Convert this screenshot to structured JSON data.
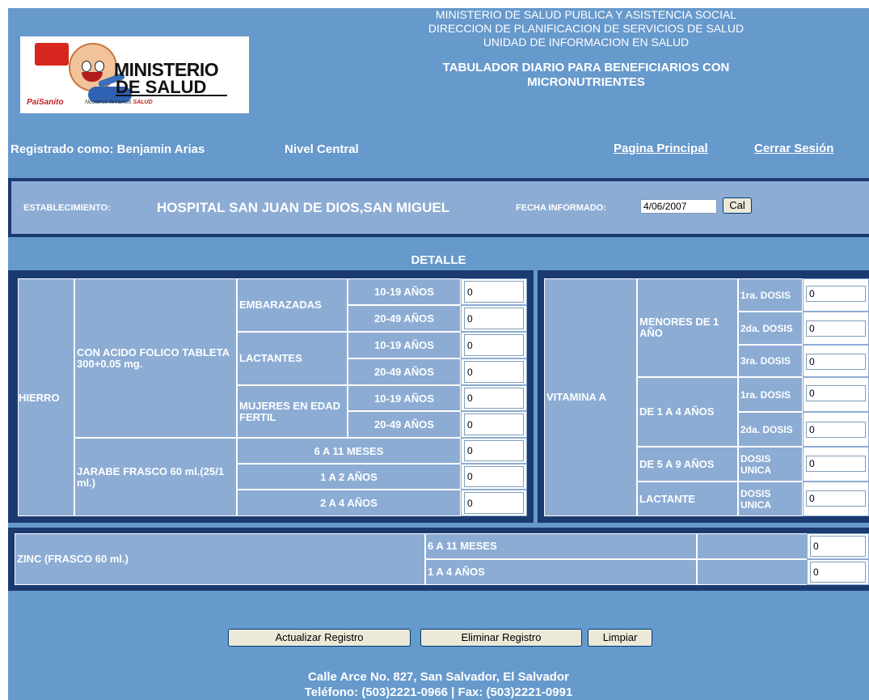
{
  "header": {
    "line1": "MINISTERIO DE SALUD PUBLICA Y ASISTENCIA SOCIAL",
    "line2": "DIRECCION DE PLANIFICACION DE SERVICIOS DE SALUD",
    "line3": "UNIDAD DE INFORMACION EN SALUD",
    "title1": "TABULADOR DIARIO PARA BENEFICIARIOS CON",
    "title2": "MICRONUTRIENTES"
  },
  "logo": {
    "line1": "MINISTERIO",
    "line2": "DE SALUD",
    "brand": "PaiSanito",
    "slogan": "Nosotros llevamos",
    "slogan_strong": "SALUD"
  },
  "user": {
    "registered_as": "Registrado como: Benjamin Arias",
    "level": "Nivel Central"
  },
  "nav": {
    "home": "Pagina Principal",
    "logout": "Cerrar Sesión"
  },
  "establishment": {
    "label": "ESTABLECIMIENTO:",
    "value": "HOSPITAL SAN JUAN DE DIOS,SAN MIGUEL",
    "date_label": "FECHA INFORMADO:",
    "date_value": "4/06/2007",
    "cal_button": "Cal"
  },
  "detail_title": "DETALLE",
  "hierro": {
    "label": "HIERRO",
    "acido_label": "CON ACIDO FOLICO TABLETA 300+0.05 mg.",
    "embarazadas": "EMBARAZADAS",
    "lactantes": "LACTANTES",
    "mujeres": "MUJERES EN EDAD FERTIL",
    "age1": "10-19 AÑOS",
    "age2": "20-49 AÑOS",
    "jarabe_label": "JARABE FRASCO 60 ml.(25/1 ml.)",
    "j1": "6 A 11 MESES",
    "j2": "1 A 2 AÑOS",
    "j3": "2 A 4 AÑOS",
    "values": [
      "0",
      "0",
      "0",
      "0",
      "0",
      "0",
      "0",
      "0",
      "0"
    ]
  },
  "vitamina": {
    "label": "VITAMINA A",
    "menores": "MENORES DE 1 AÑO",
    "d1a4": "DE 1 A 4 AÑOS",
    "d5a9": "DE 5 A 9 AÑOS",
    "lactante": "LACTANTE",
    "dosis1": "1ra. DOSIS",
    "dosis2": "2da. DOSIS",
    "dosis3": "3ra. DOSIS",
    "unica": "DOSIS UNICA",
    "values": [
      "0",
      "0",
      "0",
      "0",
      "0",
      "0",
      "0"
    ]
  },
  "zinc": {
    "label": "ZINC (FRASCO 60 ml.)",
    "r1": "6 A 11 MESES",
    "r2": "1 A 4 AÑOS",
    "values": [
      "0",
      "0"
    ]
  },
  "buttons": {
    "update": "Actualizar Registro",
    "delete": "Eliminar Registro",
    "clear": "Limpiar"
  },
  "footer": {
    "address": "Calle Arce No. 827, San Salvador, El Salvador",
    "phone": "Teléfono: (503)2221-0966 | Fax: (503)2221-0991"
  }
}
